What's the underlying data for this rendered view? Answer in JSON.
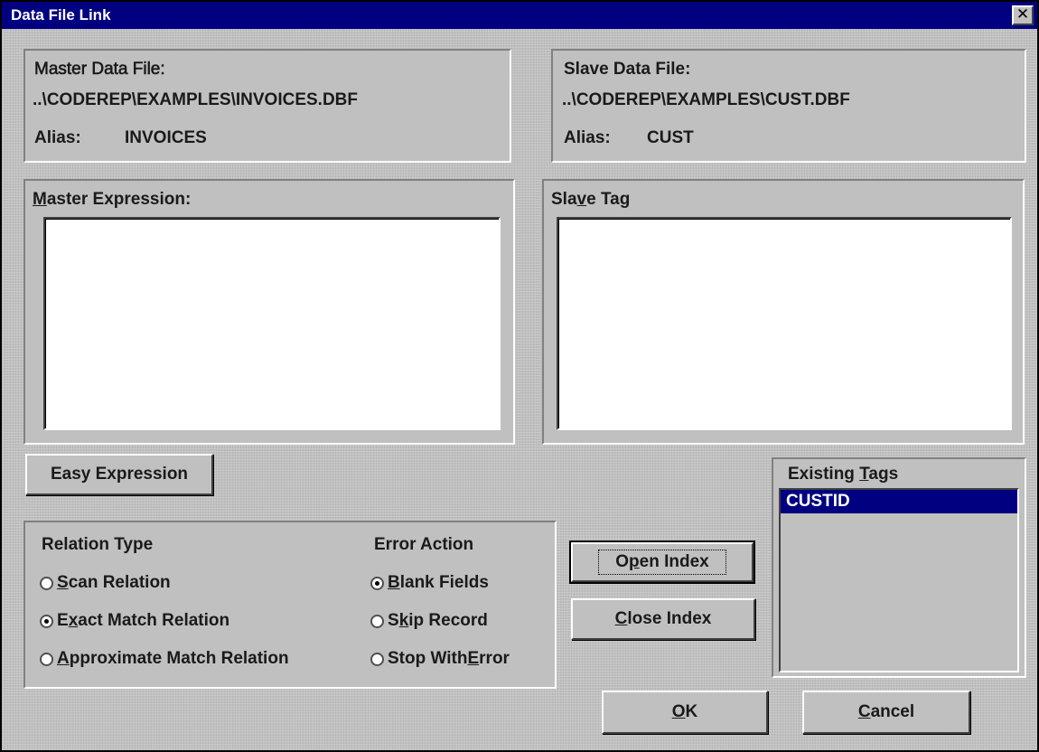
{
  "window": {
    "title": "Data File Link",
    "close_glyph": "✕"
  },
  "master_file": {
    "heading": "Master Data File:",
    "path": "..\\CODEREP\\EXAMPLES\\INVOICES.DBF",
    "alias_label": "Alias:",
    "alias_value": "INVOICES"
  },
  "slave_file": {
    "heading": "Slave Data File:",
    "path": "..\\CODEREP\\EXAMPLES\\CUST.DBF",
    "alias_label": "Alias:",
    "alias_value": "CUST"
  },
  "master_expression": {
    "label_mnemonic": "M",
    "label_rest": "aster Expression:",
    "value": ""
  },
  "slave_tag": {
    "label_before": "Sla",
    "label_mnemonic": "v",
    "label_after": "e Tag",
    "value": ""
  },
  "easy_expression_button": "Easy Expression",
  "relation_type": {
    "heading": "Relation Type",
    "options": [
      {
        "before": "",
        "mnemonic": "S",
        "after": "can Relation",
        "checked": false
      },
      {
        "before": "E",
        "mnemonic": "x",
        "after": "act Match Relation",
        "checked": true
      },
      {
        "before": "",
        "mnemonic": "A",
        "after": "pproximate Match Relation",
        "checked": false
      }
    ]
  },
  "error_action": {
    "heading": "Error Action",
    "options": [
      {
        "before": "",
        "mnemonic": "B",
        "after": "lank Fields",
        "checked": true
      },
      {
        "before": "S",
        "mnemonic": "k",
        "after": "ip Record",
        "checked": false
      },
      {
        "before": "Stop With ",
        "mnemonic": "E",
        "after": "rror",
        "checked": false
      }
    ]
  },
  "open_index_button": {
    "before": "O",
    "mnemonic": "p",
    "after": "en Index"
  },
  "close_index_button": {
    "before": "",
    "mnemonic": "C",
    "after": "lose Index"
  },
  "existing_tags": {
    "heading_before": "Existing ",
    "heading_mnemonic": "T",
    "heading_after": "ags",
    "items": [
      {
        "label": "CUSTID",
        "selected": true
      }
    ]
  },
  "ok_button": {
    "mnemonic": "O",
    "after": "K"
  },
  "cancel_button": {
    "mnemonic": "C",
    "after": "ancel"
  },
  "colors": {
    "face": "#c0c0c0",
    "titlebar": "#000080",
    "selection": "#000080"
  }
}
